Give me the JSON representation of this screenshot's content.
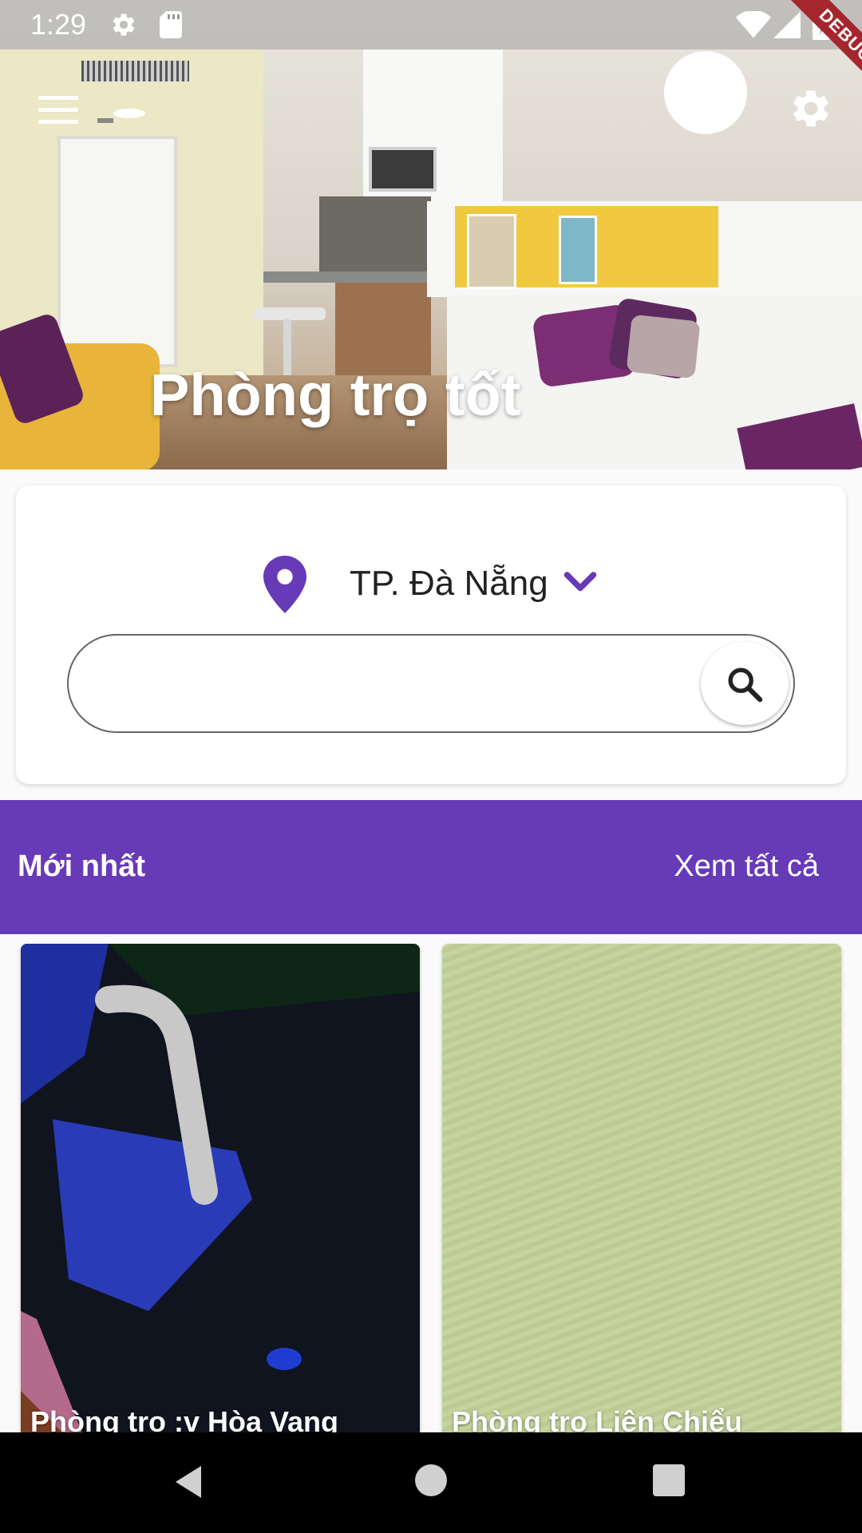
{
  "status_bar": {
    "time": "1:29",
    "icons": [
      "gear-icon",
      "sd-card-icon",
      "wifi-icon",
      "signal-icon",
      "battery-charging-icon"
    ]
  },
  "debug_banner": "DEBUG",
  "hero": {
    "title": "Phòng trọ tốt",
    "menu_icon": "menu-icon",
    "settings_icon": "settings-icon"
  },
  "search": {
    "location_icon": "location-pin-icon",
    "location": "TP. Đà Nẵng",
    "dropdown_icon": "chevron-down-icon",
    "query": "",
    "search_icon": "search-icon"
  },
  "section": {
    "title": "Mới nhất",
    "see_all": "Xem tất cả"
  },
  "listings": [
    {
      "title": "Phòng trọ :v Hòa Vang"
    },
    {
      "title": "Phòng trọ Liên Chiểu"
    }
  ],
  "colors": {
    "primary": "#673ab7",
    "debug": "#a6262d"
  },
  "nav_bar": {
    "icons": [
      "back-icon",
      "home-icon",
      "recents-icon"
    ]
  }
}
